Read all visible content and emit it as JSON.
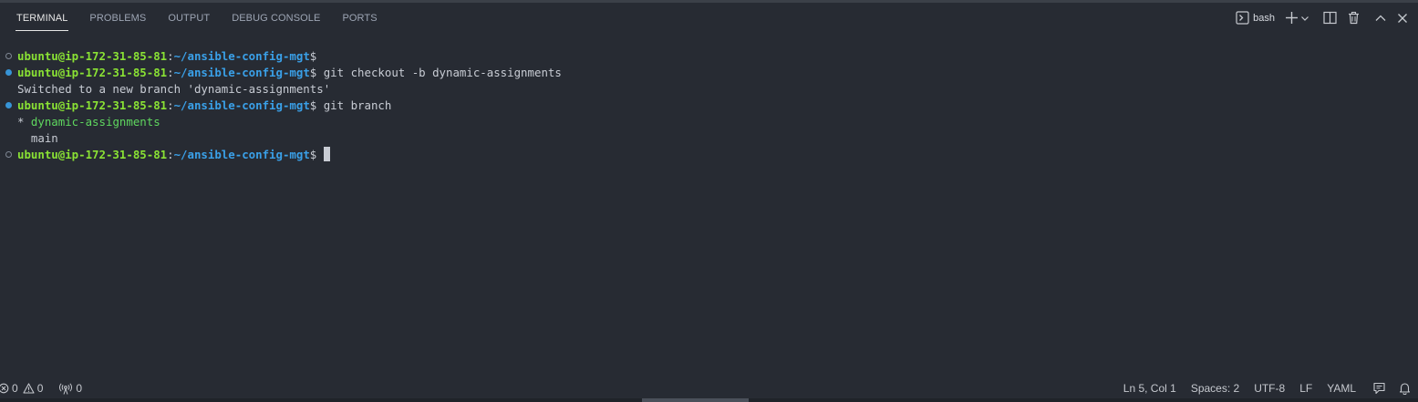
{
  "panel": {
    "tabs": [
      {
        "label": "TERMINAL",
        "active": true
      },
      {
        "label": "PROBLEMS",
        "active": false
      },
      {
        "label": "OUTPUT",
        "active": false
      },
      {
        "label": "DEBUG CONSOLE",
        "active": false
      },
      {
        "label": "PORTS",
        "active": false
      }
    ],
    "shell_name": "bash",
    "actions": [
      "terminal-icon",
      "plus-icon",
      "chevron-down-icon",
      "split-icon",
      "trash-icon",
      "chevron-up-icon",
      "close-icon"
    ]
  },
  "terminal": {
    "lines": [
      {
        "user": "ubuntu@ip-172-31-85-81",
        "sep": ":",
        "path": "~/ansible-config-mgt",
        "dollar": "$",
        "command": ""
      },
      {
        "user": "ubuntu@ip-172-31-85-81",
        "sep": ":",
        "path": "~/ansible-config-mgt",
        "dollar": "$",
        "command": " git checkout -b dynamic-assignments"
      },
      {
        "output": "Switched to a new branch 'dynamic-assignments'"
      },
      {
        "user": "ubuntu@ip-172-31-85-81",
        "sep": ":",
        "path": "~/ansible-config-mgt",
        "dollar": "$",
        "command": " git branch"
      },
      {
        "star": "* ",
        "current_branch": "dynamic-assignments"
      },
      {
        "output": "  main"
      },
      {
        "user": "ubuntu@ip-172-31-85-81",
        "sep": ":",
        "path": "~/ansible-config-mgt",
        "dollar": "$",
        "command": ""
      }
    ]
  },
  "statusbar": {
    "errors": "0",
    "warnings": "0",
    "ports": "0",
    "position": "Ln 5, Col 1",
    "spaces": "Spaces: 2",
    "encoding": "UTF-8",
    "eol": "LF",
    "language": "YAML"
  },
  "colors": {
    "background": "#272b33",
    "user_green": "#8ae234",
    "path_blue": "#3aa0e8",
    "branch_green": "#5fd75f",
    "decoration_blue": "#3794d6"
  }
}
